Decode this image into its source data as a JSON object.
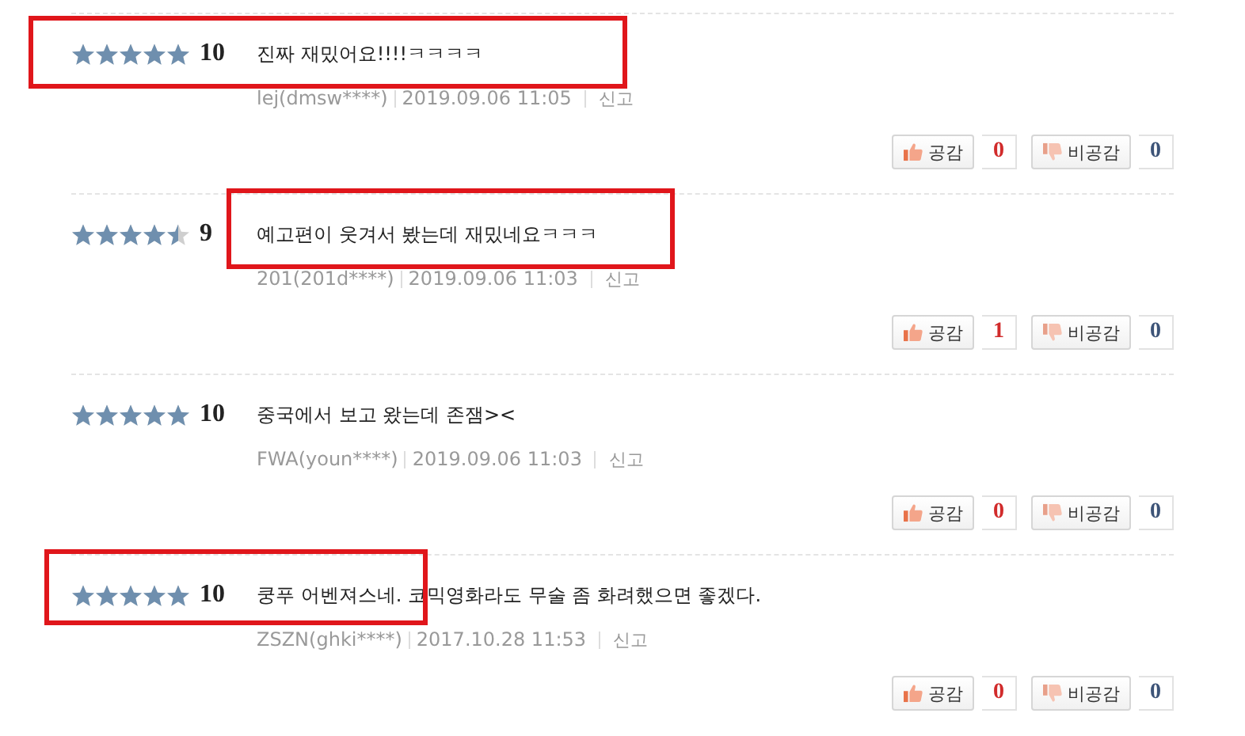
{
  "reviews": [
    {
      "stars": 5,
      "score": "10",
      "comment": "진짜 재밌어요!!!!ㅋㅋㅋㅋ",
      "author": "lej(dmsw****)",
      "date": "2019.09.06 11:05",
      "report": "신고",
      "like_label": "공감",
      "like_count": "0",
      "dislike_label": "비공감",
      "dislike_count": "0",
      "rating_highlighted": true,
      "text_highlighted": true
    },
    {
      "stars": 4.5,
      "score": "9",
      "comment": "예고편이 웃겨서 봤는데 재밌네요ㅋㅋㅋ",
      "author": "201(201d****)",
      "date": "2019.09.06 11:03",
      "report": "신고",
      "like_label": "공감",
      "like_count": "1",
      "dislike_label": "비공감",
      "dislike_count": "0",
      "rating_highlighted": false,
      "text_highlighted": true
    },
    {
      "stars": 5,
      "score": "10",
      "comment": "중국에서 보고 왔는데 존잼><",
      "author": "FWA(youn****)",
      "date": "2019.09.06 11:03",
      "report": "신고",
      "like_label": "공감",
      "like_count": "0",
      "dislike_label": "비공감",
      "dislike_count": "0",
      "rating_highlighted": false,
      "text_highlighted": false
    },
    {
      "stars": 5,
      "score": "10",
      "comment": "쿵푸 어벤져스네. 코믹영화라도 무술 좀 화려했으면 좋겠다.",
      "author": "ZSZN(ghki****)",
      "date": "2017.10.28 11:53",
      "report": "신고",
      "like_label": "공감",
      "like_count": "0",
      "dislike_label": "비공감",
      "dislike_count": "0",
      "rating_highlighted": true,
      "text_highlighted": false
    }
  ]
}
